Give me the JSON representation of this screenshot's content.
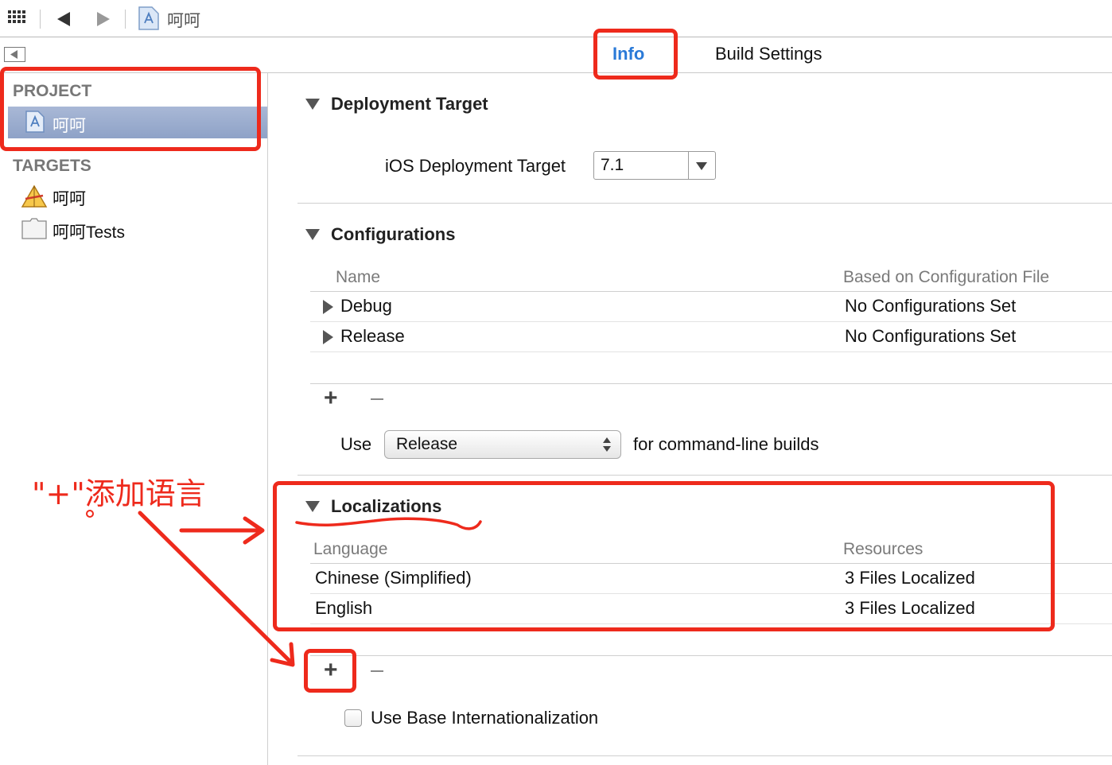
{
  "toolbar": {
    "breadcrumb": "呵呵",
    "icons": [
      "grid-icon",
      "back-arrow-icon",
      "forward-arrow-icon",
      "project-file-icon"
    ]
  },
  "tabs": {
    "info": "Info",
    "build_settings": "Build Settings",
    "active": "Info"
  },
  "sidebar": {
    "project_header": "PROJECT",
    "project_item": "呵呵",
    "targets_header": "TARGETS",
    "targets": [
      "呵呵",
      "呵呵Tests"
    ]
  },
  "deployment": {
    "title": "Deployment Target",
    "ios_label": "iOS Deployment Target",
    "ios_value": "7.1"
  },
  "configurations": {
    "title": "Configurations",
    "col_name": "Name",
    "col_file": "Based on Configuration File",
    "rows": [
      {
        "name": "Debug",
        "file": "No Configurations Set"
      },
      {
        "name": "Release",
        "file": "No Configurations Set"
      }
    ],
    "add": "+",
    "use_label": "Use",
    "use_value": "Release",
    "use_suffix": "for command-line builds"
  },
  "localizations": {
    "title": "Localizations",
    "col_language": "Language",
    "col_resources": "Resources",
    "rows": [
      {
        "language": "Chinese (Simplified)",
        "resources": "3 Files Localized"
      },
      {
        "language": "English",
        "resources": "3 Files Localized"
      }
    ],
    "add": "+",
    "base_intl_label": "Use Base Internationalization"
  },
  "annotation": {
    "text": "\"+\"添加语言",
    "color": "#ee2a1c"
  },
  "colors": {
    "accent": "#2a7ad8",
    "selection": "#8ea2c7",
    "annotation_red": "#ee2a1c"
  }
}
